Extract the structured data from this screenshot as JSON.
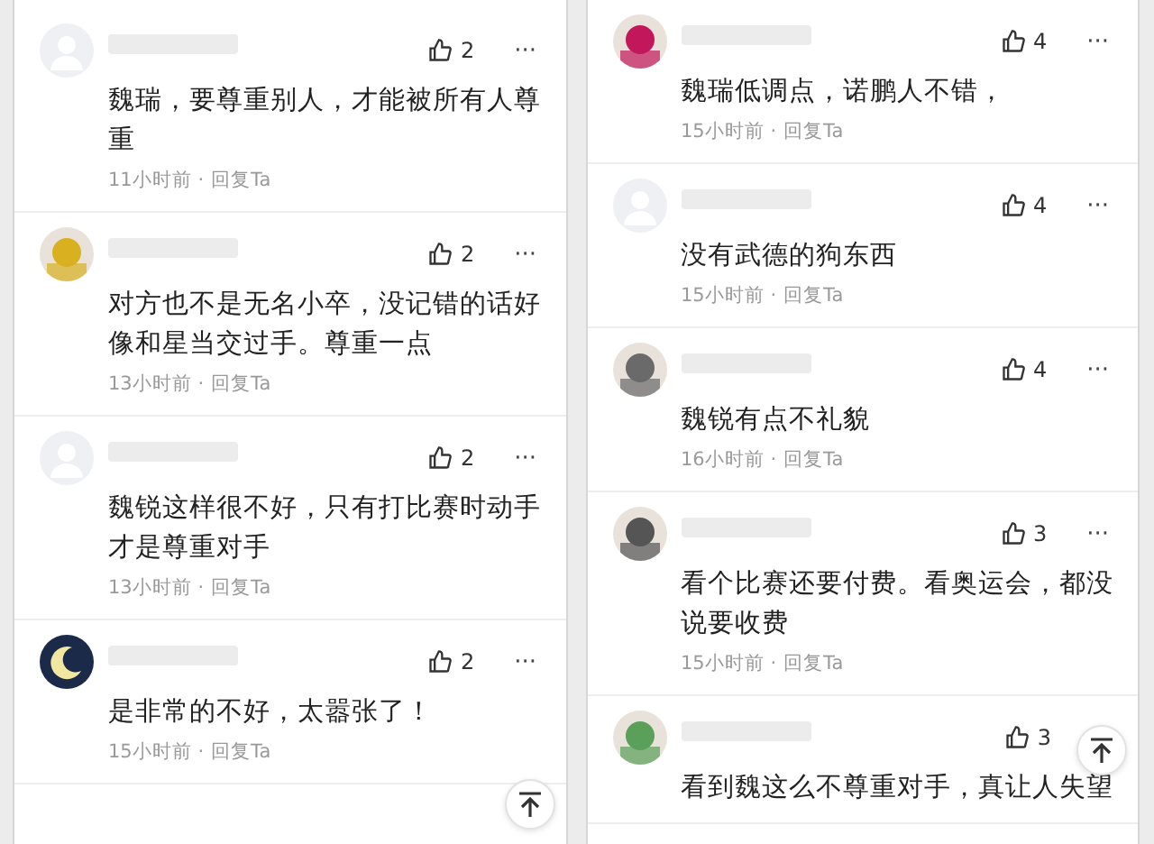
{
  "panels": [
    {
      "comments": [
        {
          "avatar": {
            "kind": "default"
          },
          "likes": "2",
          "more": "···",
          "text": "魏瑞，要尊重别人，才能被所有人尊重",
          "time": "11小时前 ·",
          "reply": "回复Ta"
        },
        {
          "likes": "2",
          "more": "···",
          "text": "对方也不是无名小卒，没记错的话好像和星当交过手。尊重一点",
          "time": "13小时前 ·",
          "reply": "回复Ta"
        },
        {
          "avatar": {
            "kind": "default"
          },
          "likes": "2",
          "more": "···",
          "text": "魏锐这样很不好，只有打比赛时动手才是尊重对手",
          "time": "13小时前 ·",
          "reply": "回复Ta"
        },
        {
          "avatar": {
            "kind": "moon",
            "color": "#1c2a4a"
          },
          "likes": "2",
          "more": "···",
          "text": "是非常的不好，太嚣张了！",
          "time": "15小时前 ·",
          "reply": "回复Ta"
        }
      ]
    },
    {
      "comments": [
        {
          "likes": "4",
          "more": "···",
          "text": "魏瑞低调点，诺鹏人不错，",
          "time": "15小时前 ·",
          "reply": "回复Ta"
        },
        {
          "avatar": {
            "kind": "default"
          },
          "likes": "4",
          "more": "···",
          "text": "没有武德的狗东西",
          "time": "15小时前 ·",
          "reply": "回复Ta"
        },
        {
          "likes": "4",
          "more": "···",
          "text": "魏锐有点不礼貌",
          "time": "16小时前 ·",
          "reply": "回复Ta"
        },
        {
          "likes": "3",
          "more": "···",
          "text": "看个比赛还要付费。看奥运会，都没说要收费",
          "time": "15小时前 ·",
          "reply": "回复Ta"
        },
        {
          "likes": "3",
          "text": "看到魏这么不尊重对手，真让人失望"
        }
      ]
    }
  ]
}
